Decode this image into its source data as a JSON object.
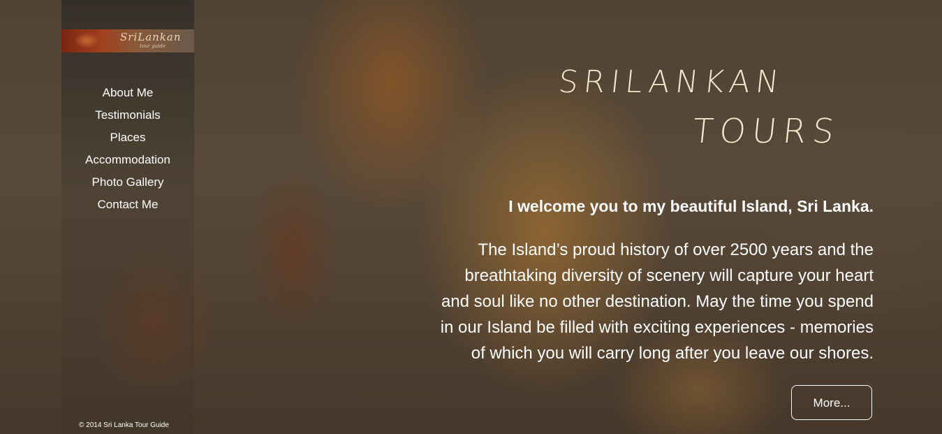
{
  "colors": {
    "text": "#ffffff",
    "brand_text": "#f3e8cf",
    "sidebar_bg": "#2d2a26",
    "background_tone": "#7a6550"
  },
  "logo": {
    "title": "SriLankan",
    "subtitle": "tour guide"
  },
  "nav": {
    "items": [
      {
        "label": "About Me"
      },
      {
        "label": "Testimonials"
      },
      {
        "label": "Places"
      },
      {
        "label": "Accommodation"
      },
      {
        "label": "Photo Gallery"
      },
      {
        "label": "Contact Me"
      }
    ]
  },
  "footer": {
    "copyright": "© 2014 Sri Lanka Tour Guide"
  },
  "brand": {
    "line1": "SRILANKAN",
    "line2": "TOURS"
  },
  "main": {
    "welcome": "I welcome you to my beautiful Island, Sri Lanka.",
    "intro_lines": [
      "The Island’s proud history of over 2500 years and the",
      "breathtaking diversity of scenery will capture your heart",
      "and soul like no other destination. May the time you spend",
      "in our Island be filled with exciting experiences - memories",
      "of which you will carry long after you leave our shores."
    ],
    "more_label": "More..."
  }
}
